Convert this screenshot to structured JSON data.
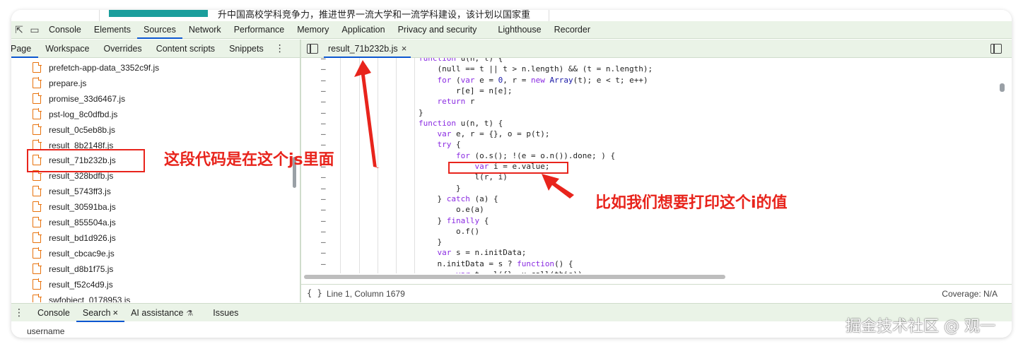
{
  "webpage": {
    "headline": "升中国高校学科竞争力，推进世界一流大学和一流学科建设，该计划以国家重"
  },
  "toolbar": {
    "tabs": [
      "Console",
      "Elements",
      "Sources",
      "Network",
      "Performance",
      "Memory",
      "Application",
      "Privacy and security",
      "Lighthouse",
      "Recorder"
    ],
    "active": "Sources"
  },
  "navigator": {
    "tabs": [
      "Page",
      "Workspace",
      "Overrides",
      "Content scripts",
      "Snippets"
    ],
    "active": "Page",
    "files": [
      "prefetch-app-data_3352c9f.js",
      "prepare.js",
      "promise_33d6467.js",
      "pst-log_8c0dfbd.js",
      "result_0c5eb8b.js",
      "result_8b2148f.js",
      "result_71b232b.js",
      "result_328bdfb.js",
      "result_5743ff3.js",
      "result_30591ba.js",
      "result_855504a.js",
      "result_bd1d926.js",
      "result_cbcac9e.js",
      "result_d8b1f75.js",
      "result_f52c4d9.js",
      "swfobject_0178953.js"
    ],
    "selected_index": 6
  },
  "editor": {
    "file_tab": "result_71b232b.js",
    "code_lines": [
      "function u(n, t) {",
      "    (null == t || t > n.length) && (t = n.length);",
      "    for (var e = 0, r = new Array(t); e < t; e++)",
      "        r[e] = n[e];",
      "    return r",
      "}",
      "function u(n, t) {",
      "    var e, r = {}, o = p(t);",
      "    try {",
      "        for (o.s(); !(e = o.n()).done; ) {",
      "            var i = e.value;",
      "            l(r, i)",
      "        }",
      "    } catch (a) {",
      "        o.e(a)",
      "    } finally {",
      "        o.f()",
      "    }",
      "    var s = n.initData;",
      "    n.initData = s ? function() {",
      "        var t = l({}, u.call(this)), ..."
    ]
  },
  "status": {
    "braces": "{ }",
    "position": "Line 1, Column 1679",
    "coverage": "Coverage: N/A"
  },
  "drawer": {
    "tabs": [
      "Console",
      "Search",
      "AI assistance",
      "Issues"
    ],
    "active": "Search",
    "input_text": "username"
  },
  "annotations": {
    "file_note": "这段代码是在这个js里面",
    "var_note": "比如我们想要打印这个i的值",
    "color": "#e8241c"
  },
  "watermark": "掘金技术社区 @ 观一"
}
